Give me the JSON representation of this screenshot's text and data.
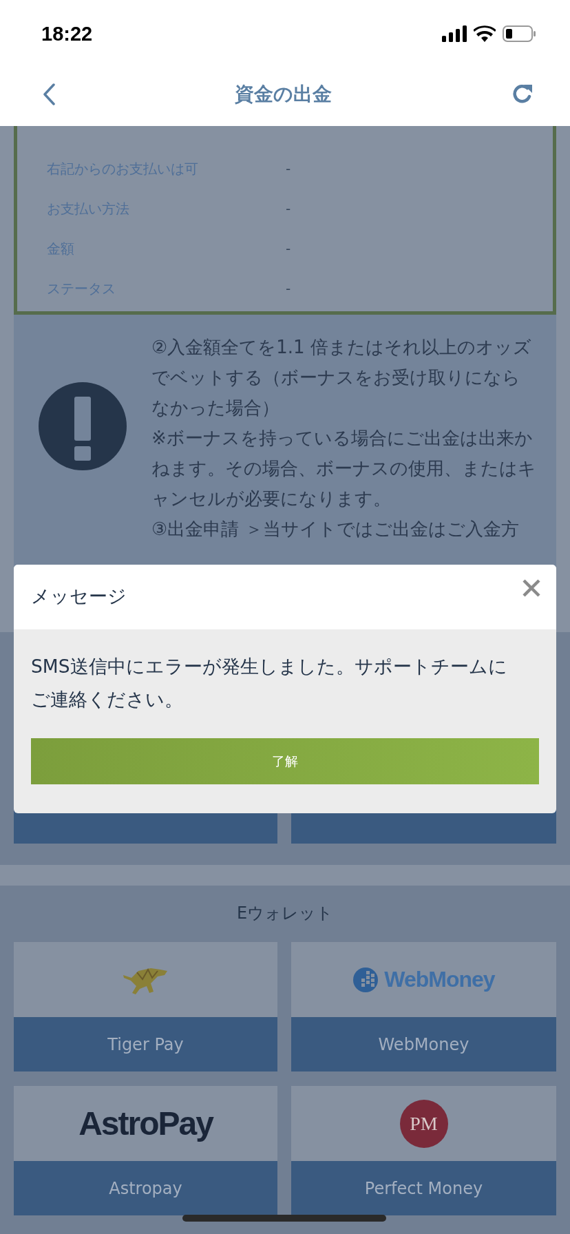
{
  "status_bar": {
    "time": "18:22"
  },
  "nav": {
    "title": "資金の出金"
  },
  "request_details": [
    {
      "label": "右記からのお支払いは可",
      "value": "-"
    },
    {
      "label": "お支払い方法",
      "value": "-"
    },
    {
      "label": "金額",
      "value": "-"
    },
    {
      "label": "ステータス",
      "value": "-"
    }
  ],
  "warning": {
    "paragraphs": [
      "②入金額全てを1.1 倍またはそれ以上のオッズでベットする（ボーナスをお受け取りにならなかった場合）",
      "※ボーナスを持っている場合にご出金は出来かねます。その場合、ボーナスの使用、またはキャンセルが必要になります。",
      "③出金申請 ＞当サイトではご出金はご入金方"
    ]
  },
  "e_wallets": {
    "title": "Eウォレット",
    "methods": [
      {
        "name": "Tiger Pay",
        "kind": "tiger"
      },
      {
        "name": "WebMoney",
        "kind": "globe",
        "logo_text": "WebMoney"
      },
      {
        "name": "Astropay",
        "kind": "wordmark",
        "logo_text": "AstroPay"
      },
      {
        "name": "Perfect Money",
        "kind": "seal",
        "logo_text": "PM"
      }
    ]
  },
  "dialog": {
    "title": "メッセージ",
    "message": "SMS送信中にエラーが発生しました。サポートチームにご連絡ください。",
    "button": "了解"
  }
}
